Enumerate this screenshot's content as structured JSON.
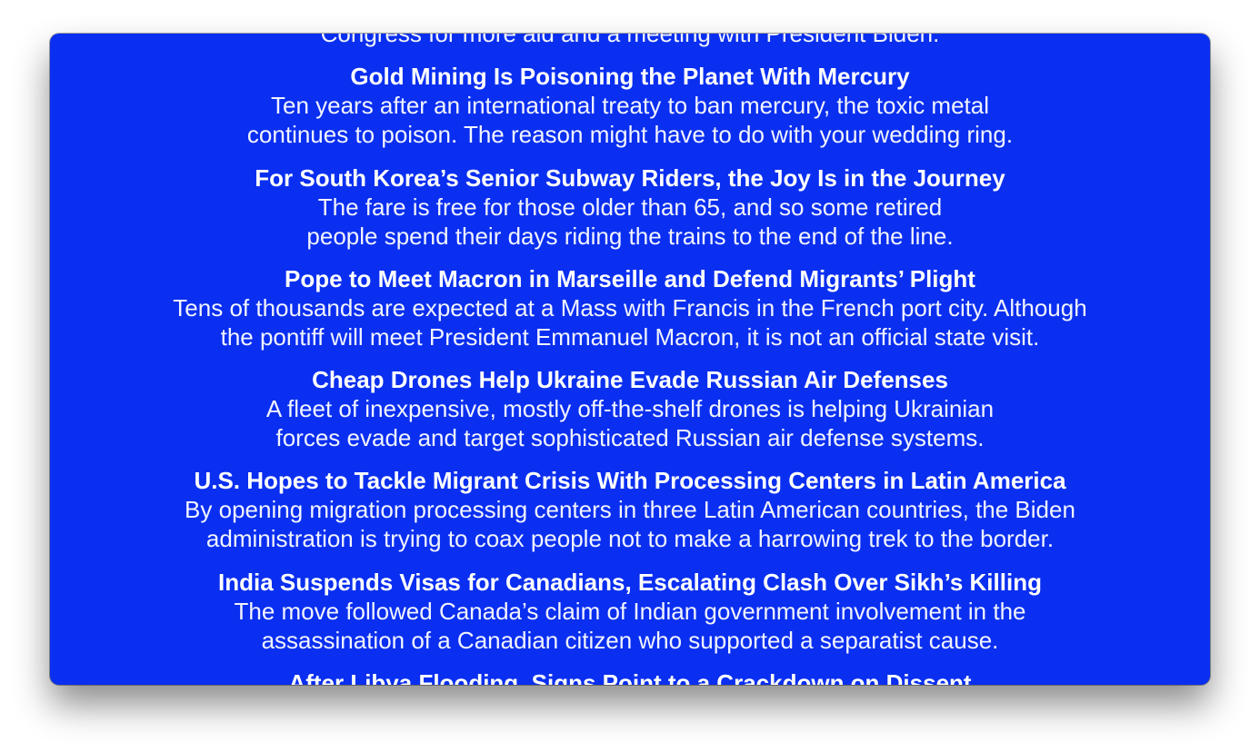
{
  "stories": [
    {
      "headline": "",
      "summary_lines": [
        "Congress for more aid and a meeting with President Biden."
      ]
    },
    {
      "headline": "Gold Mining Is Poisoning the Planet With Mercury",
      "summary_lines": [
        "Ten years after an international treaty to ban mercury, the toxic metal",
        "continues to poison. The reason might have to do with your wedding ring."
      ]
    },
    {
      "headline": "For South Korea’s Senior Subway Riders, the Joy Is in the Journey",
      "summary_lines": [
        "The fare is free for those older than 65, and so some retired",
        "people spend their days riding the trains to the end of the line."
      ]
    },
    {
      "headline": "Pope to Meet Macron in Marseille and Defend Migrants’ Plight",
      "summary_lines": [
        "Tens of thousands are expected at a Mass with Francis in the French port city. Although",
        "the pontiff will meet President Emmanuel Macron, it is not an official state visit."
      ]
    },
    {
      "headline": "Cheap Drones Help Ukraine Evade Russian Air Defenses",
      "summary_lines": [
        "A fleet of inexpensive, mostly off-the-shelf drones is helping Ukrainian",
        "forces evade and target sophisticated Russian air defense systems."
      ]
    },
    {
      "headline": "U.S. Hopes to Tackle Migrant Crisis With Processing Centers in Latin America",
      "summary_lines": [
        "By opening migration processing centers in three Latin American countries, the Biden",
        "administration is trying to coax people not to make a harrowing trek to the border."
      ]
    },
    {
      "headline": "India Suspends Visas for Canadians, Escalating Clash Over Sikh’s Killing",
      "summary_lines": [
        "The move followed Canada’s claim of Indian government involvement in the",
        "assassination of a Canadian citizen who supported a separatist cause."
      ]
    },
    {
      "headline": "After Libya Flooding, Signs Point to a Crackdown on Dissent",
      "summary_lines": []
    }
  ],
  "colors": {
    "background": "#0a2ff0",
    "text": "#ffffff"
  }
}
